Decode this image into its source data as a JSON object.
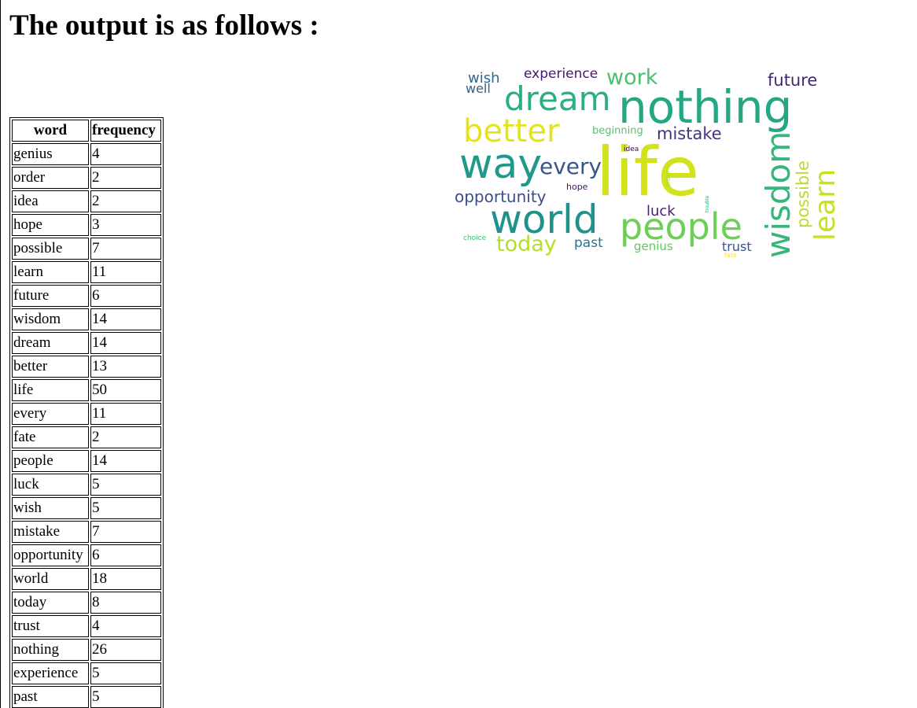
{
  "heading": "The output is as follows :",
  "table": {
    "headers": [
      "word",
      "frequency"
    ],
    "rows": [
      [
        "genius",
        "4"
      ],
      [
        "order",
        "2"
      ],
      [
        "idea",
        "2"
      ],
      [
        "hope",
        "3"
      ],
      [
        "possible",
        "7"
      ],
      [
        "learn",
        "11"
      ],
      [
        "future",
        "6"
      ],
      [
        "wisdom",
        "14"
      ],
      [
        "dream",
        "14"
      ],
      [
        "better",
        "13"
      ],
      [
        "life",
        "50"
      ],
      [
        "every",
        "11"
      ],
      [
        "fate",
        "2"
      ],
      [
        "people",
        "14"
      ],
      [
        "luck",
        "5"
      ],
      [
        "wish",
        "5"
      ],
      [
        "mistake",
        "7"
      ],
      [
        "opportunity",
        "6"
      ],
      [
        "world",
        "18"
      ],
      [
        "today",
        "8"
      ],
      [
        "trust",
        "4"
      ],
      [
        "nothing",
        "26"
      ],
      [
        "experience",
        "5"
      ],
      [
        "past",
        "5"
      ]
    ]
  },
  "wordcloud": {
    "words": [
      {
        "text": "life",
        "color": "#d2e21b"
      },
      {
        "text": "nothing",
        "color": "#26a784"
      },
      {
        "text": "world",
        "color": "#21918c"
      },
      {
        "text": "people",
        "color": "#6ece58"
      },
      {
        "text": "way",
        "color": "#1f9a8a"
      },
      {
        "text": "dream",
        "color": "#2ab07f"
      },
      {
        "text": "better",
        "color": "#e5e419"
      },
      {
        "text": "wisdom",
        "color": "#35b779"
      },
      {
        "text": "learn",
        "color": "#c8e020"
      },
      {
        "text": "work",
        "color": "#4ac16d"
      },
      {
        "text": "every",
        "color": "#39568c"
      },
      {
        "text": "today",
        "color": "#b5de2b"
      },
      {
        "text": "possible",
        "color": "#b8de29"
      },
      {
        "text": "future",
        "color": "#482475"
      },
      {
        "text": "mistake",
        "color": "#46327e"
      },
      {
        "text": "opportunity",
        "color": "#3e4c8a"
      },
      {
        "text": "experience",
        "color": "#481769"
      },
      {
        "text": "luck",
        "color": "#481f70"
      },
      {
        "text": "past",
        "color": "#2c728e"
      },
      {
        "text": "genius",
        "color": "#5ec962"
      },
      {
        "text": "trust",
        "color": "#3b518b"
      },
      {
        "text": "wish",
        "color": "#31688e"
      },
      {
        "text": "well",
        "color": "#365d8d"
      },
      {
        "text": "beginning",
        "color": "#52c569"
      },
      {
        "text": "hope",
        "color": "#471365"
      },
      {
        "text": "idea",
        "color": "#440154"
      },
      {
        "text": "order",
        "color": "#a0da39"
      },
      {
        "text": "trouble",
        "color": "#22a884"
      },
      {
        "text": "choice",
        "color": "#42be71"
      },
      {
        "text": "fate",
        "color": "#fde725"
      }
    ]
  }
}
